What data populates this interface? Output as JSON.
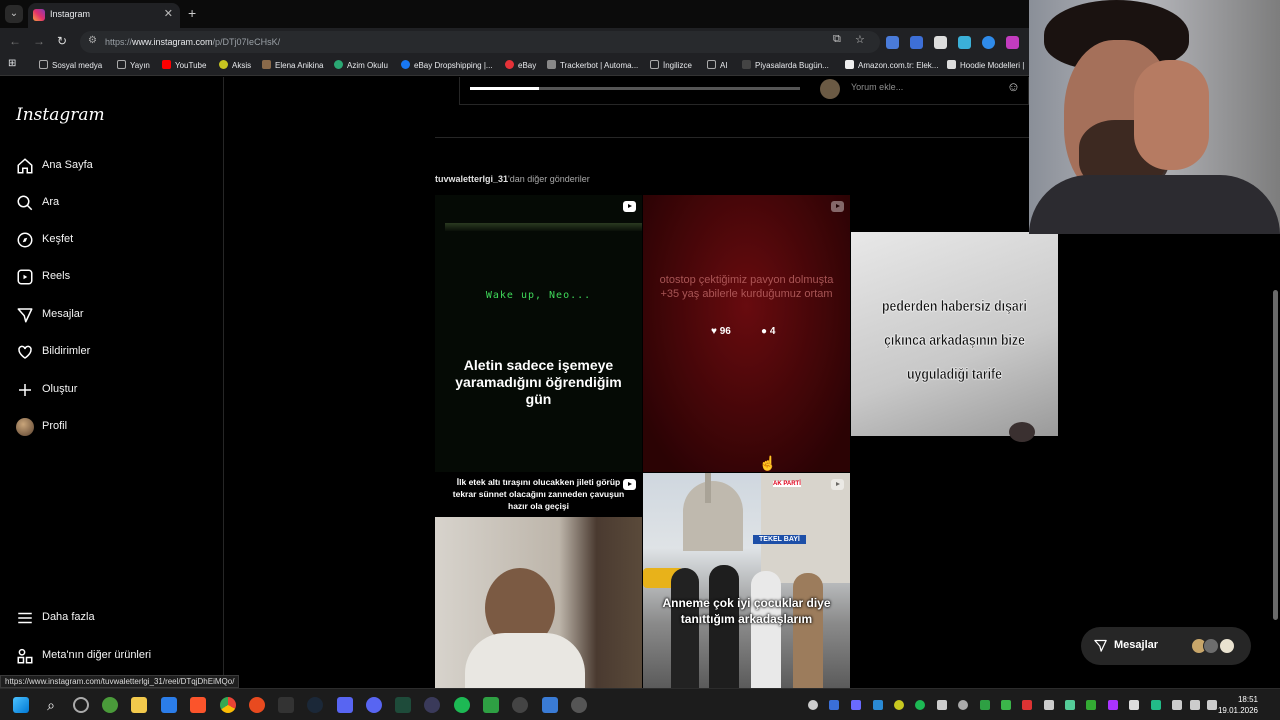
{
  "browser": {
    "tab_title": "Instagram",
    "tab_close": "✕",
    "new_tab": "+",
    "url_prefix": "https://",
    "url_host": "www.instagram.com",
    "url_path": "/p/DTj07IeCHsK/",
    "bookmarks": [
      "Sosyal medya",
      "Yayın",
      "YouTube",
      "Aksis",
      "Elena Anikina",
      "Azim Okulu",
      "eBay Dropshipping |...",
      "eBay",
      "Trackerbot | Automa...",
      "İngilizce",
      "AI",
      "Piyasalarda Bugün...",
      "Amazon.com.tr: Elek...",
      "Hoodie Modelleri |"
    ]
  },
  "instagram": {
    "logo": "Instagram",
    "nav": [
      "Ana Sayfa",
      "Ara",
      "Keşfet",
      "Reels",
      "Mesajlar",
      "Bildirimler",
      "Oluştur",
      "Profil"
    ],
    "more": "Daha fazla",
    "meta": "Meta'nın diğer ürünleri",
    "comment_placeholder": "Yorum ekle...",
    "video_progress": 0.21,
    "more_posts_user": "tuvwaletterlgi_31",
    "more_posts_suffix": "'dan diğer gönderiler",
    "posts": [
      {
        "caption": "Aletin sadece işemeye yaramadığını öğrendiğim gün",
        "overlay": "Wake up, Neo..."
      },
      {
        "caption": "otostop çektiğimiz pavyon dolmuşta +35 yaş abilerle kurduğumuz ortam",
        "likes": "96",
        "comments": "4"
      },
      {
        "caption": "pederden habersiz dışari çıkınca arkadaşının bize uyguladiği tarife"
      },
      {
        "caption": "İlk etek altı tıraşını olucakken jileti görüp tekrar sünnet olacağını zanneden çavuşun hazır ola geçişi"
      },
      {
        "caption": "Anneme çok iyi çocuklar diye tanıttığım arkadaşlarım",
        "signs": [
          "TEKEL BAYİ",
          "AK PARTİ"
        ]
      }
    ],
    "messages_pill": "Mesajlar"
  },
  "status_url": "https://www.instagram.com/tuvwaletterlgi_31/reel/DTqjDhEiMQo/",
  "taskbar": {
    "time": "18:51",
    "date": "19.01.2026"
  }
}
